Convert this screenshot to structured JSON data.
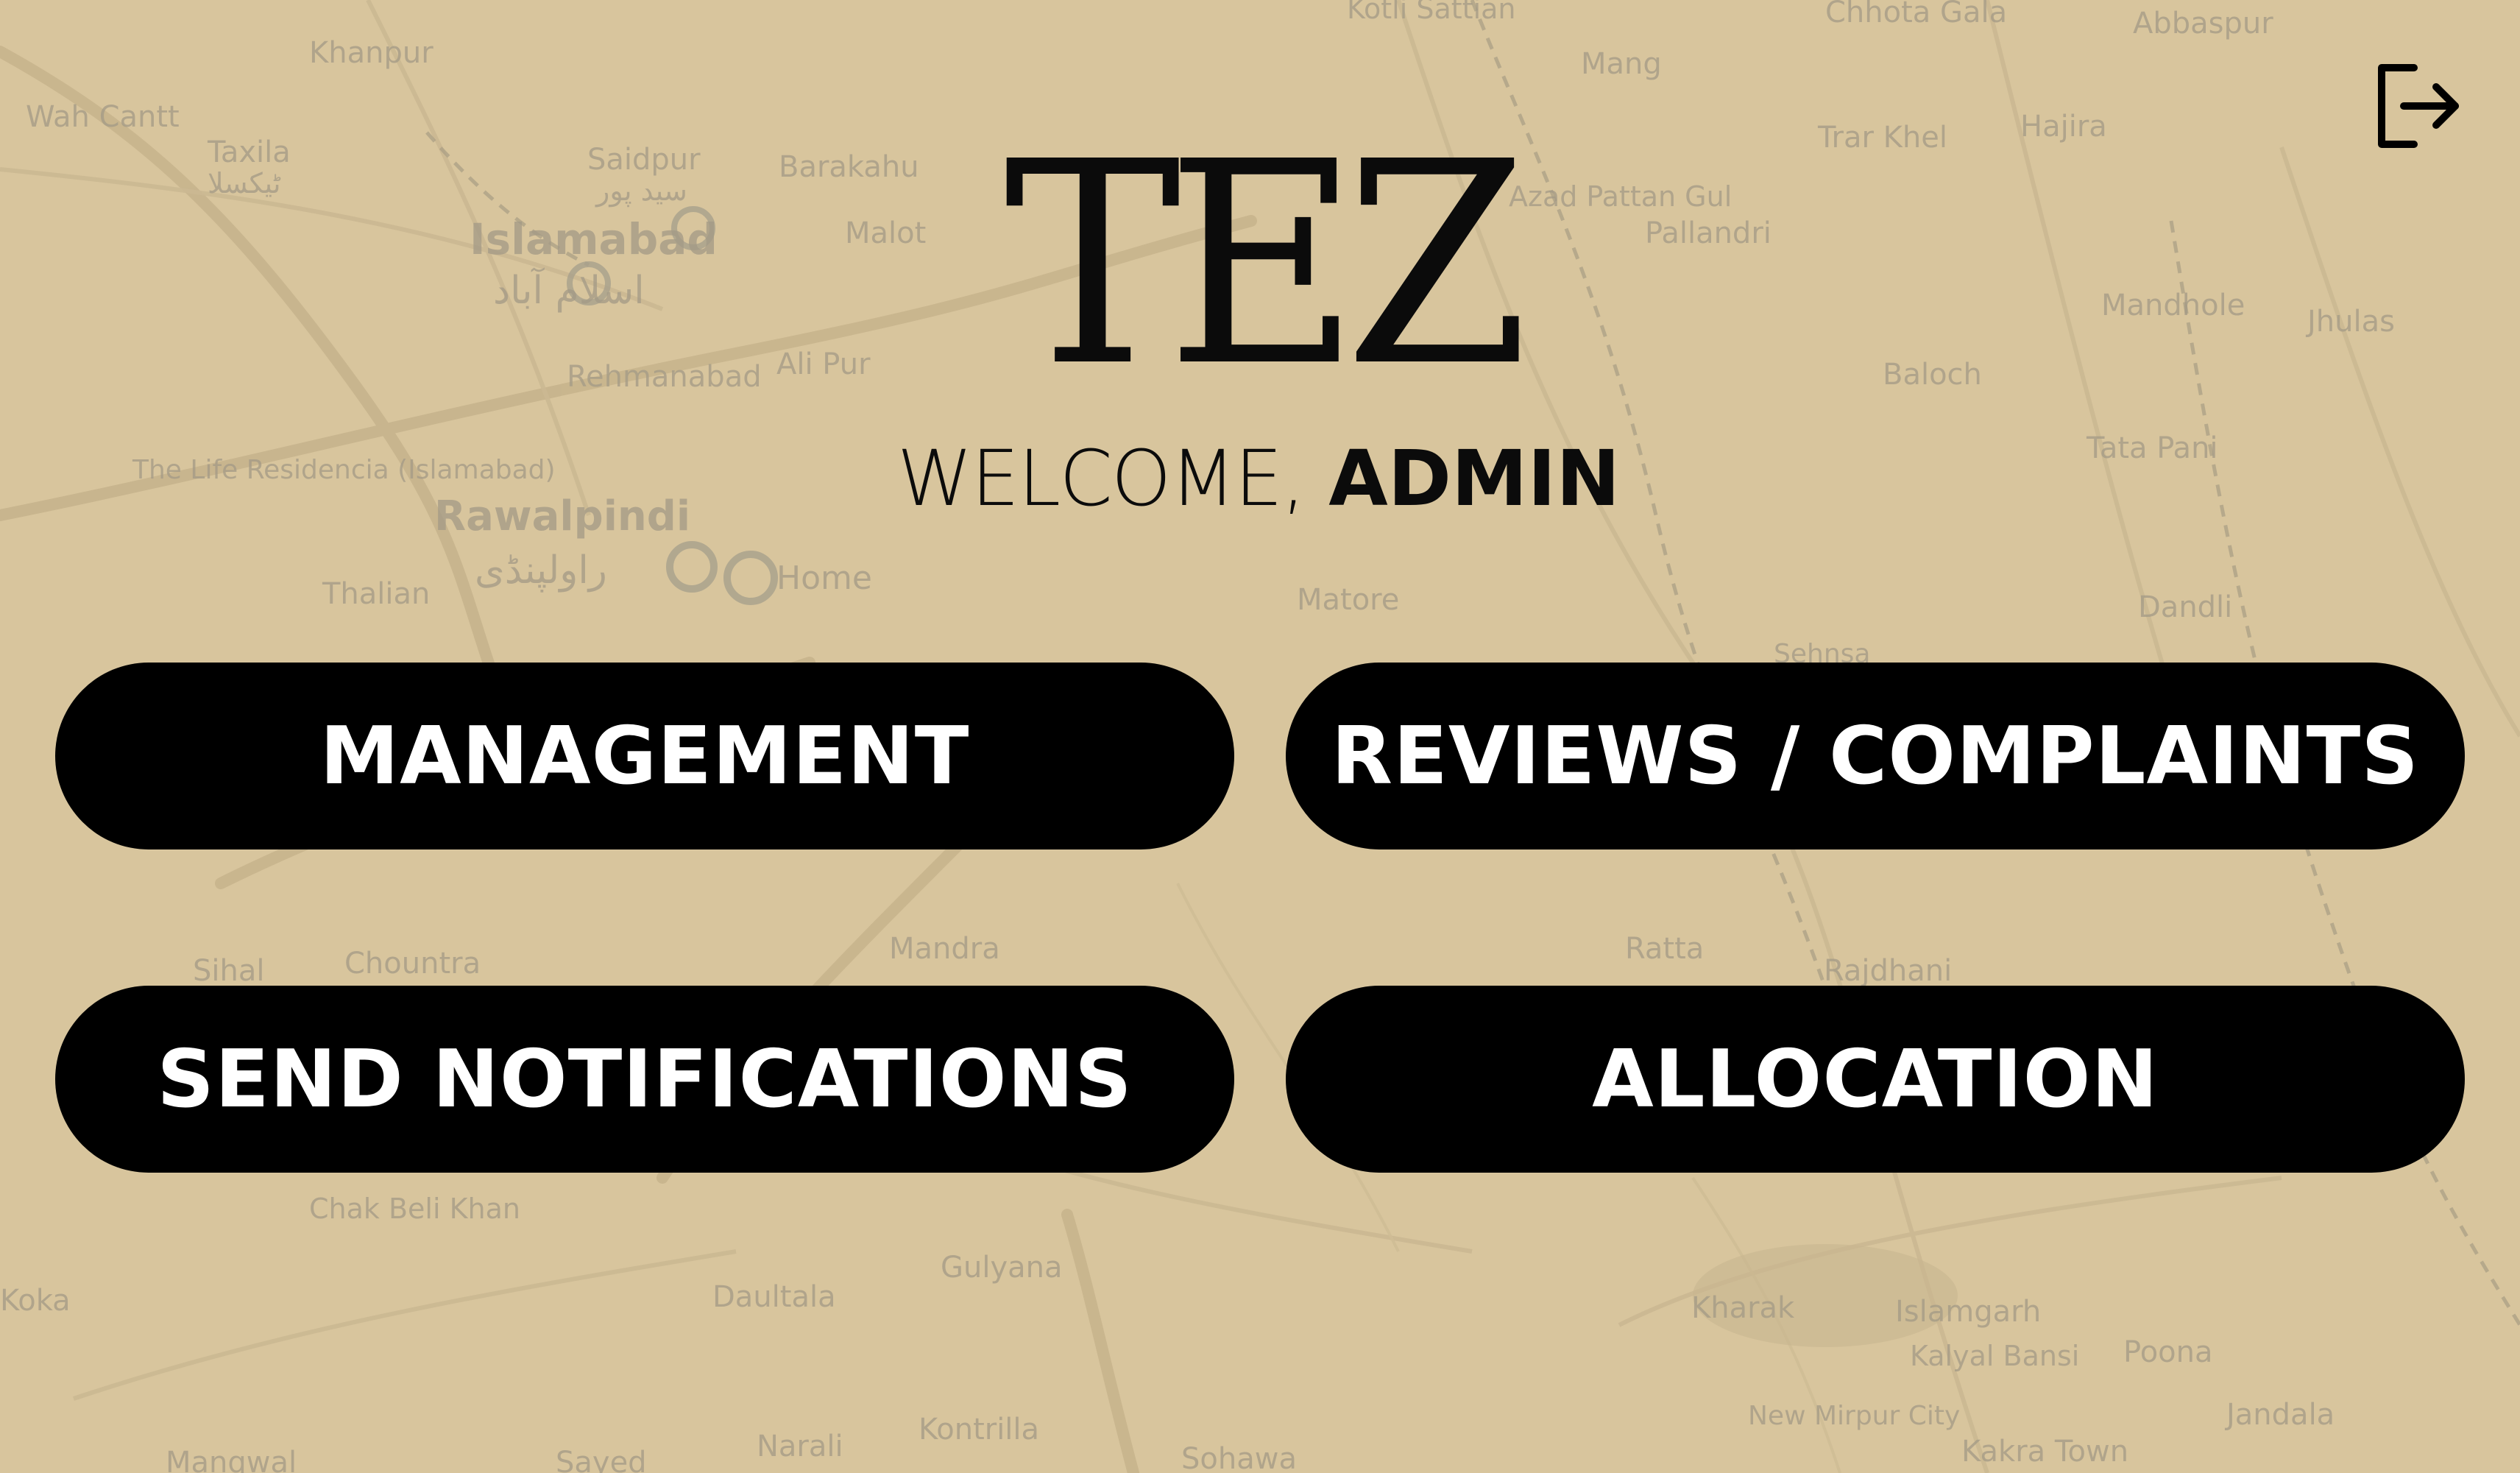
{
  "app": {
    "logo_text": "TEZ",
    "welcome_prefix": "WELCOME,",
    "welcome_name": "ADMIN"
  },
  "header": {
    "logout_icon": "logout-icon"
  },
  "menu": {
    "management": "MANAGEMENT",
    "reviews_complaints": "REVIEWS / COMPLAINTS",
    "send_notifications": "SEND NOTIFICATIONS",
    "allocation": "ALLOCATION"
  },
  "map": {
    "labels": {
      "khanpur": "Khanpur",
      "wah_cantt": "Wah Cantt",
      "taxila": "Taxila",
      "taxila_ur": "ٹیکسلا",
      "saidpur": "Saidpur",
      "saidpur_ur": "سید پور",
      "barakahu": "Barakahu",
      "islamabad": "Islamabad",
      "islamabad_ur": "اسلام آباد",
      "malot": "Malot",
      "rehmanabad": "Rehmanabad",
      "ali_pur": "Ali Pur",
      "the_life_residencia": "The Life Residencia (Islamabad)",
      "rawalpindi": "Rawalpindi",
      "rawalpindi_ur": "راولپنڈی",
      "home": "Home",
      "thalian": "Thalian",
      "kotli_sattian": "Kotli Sattian",
      "mang": "Mang",
      "chhota_gala": "Chhota Gala",
      "abbaspur": "Abbaspur",
      "trar_khel": "Trar Khel",
      "hajira": "Hajira",
      "azad_pattan": "Azad Pattan Gul",
      "pallandri": "Pallandri",
      "mandhole": "Mandhole",
      "jhulas": "Jhulas",
      "baloch": "Baloch",
      "tata_pani": "Tata Pani",
      "dandli": "Dandli",
      "sehnsa": "Sehnsa",
      "matore": "Matore",
      "mandra": "Mandra",
      "chountra": "Chountra",
      "sihal": "Sihal",
      "ratta": "Ratta",
      "rajdhani": "Rajdhani",
      "chak_beli_khan": "Chak Beli Khan",
      "daultala": "Daultala",
      "gulyana": "Gulyana",
      "kharak": "Kharak",
      "islamgarh": "Islamgarh",
      "kalyal_bansi": "Kalyal Bansi",
      "new_mirpur": "New Mirpur City",
      "poona": "Poona",
      "jandala": "Jandala",
      "kakra_town": "Kakra Town",
      "narali": "Narali",
      "kontrilla": "Kontrilla",
      "sohawa": "Sohawa",
      "manqwal": "Manqwal",
      "sayed": "Sayed",
      "koka": "Koka"
    }
  }
}
